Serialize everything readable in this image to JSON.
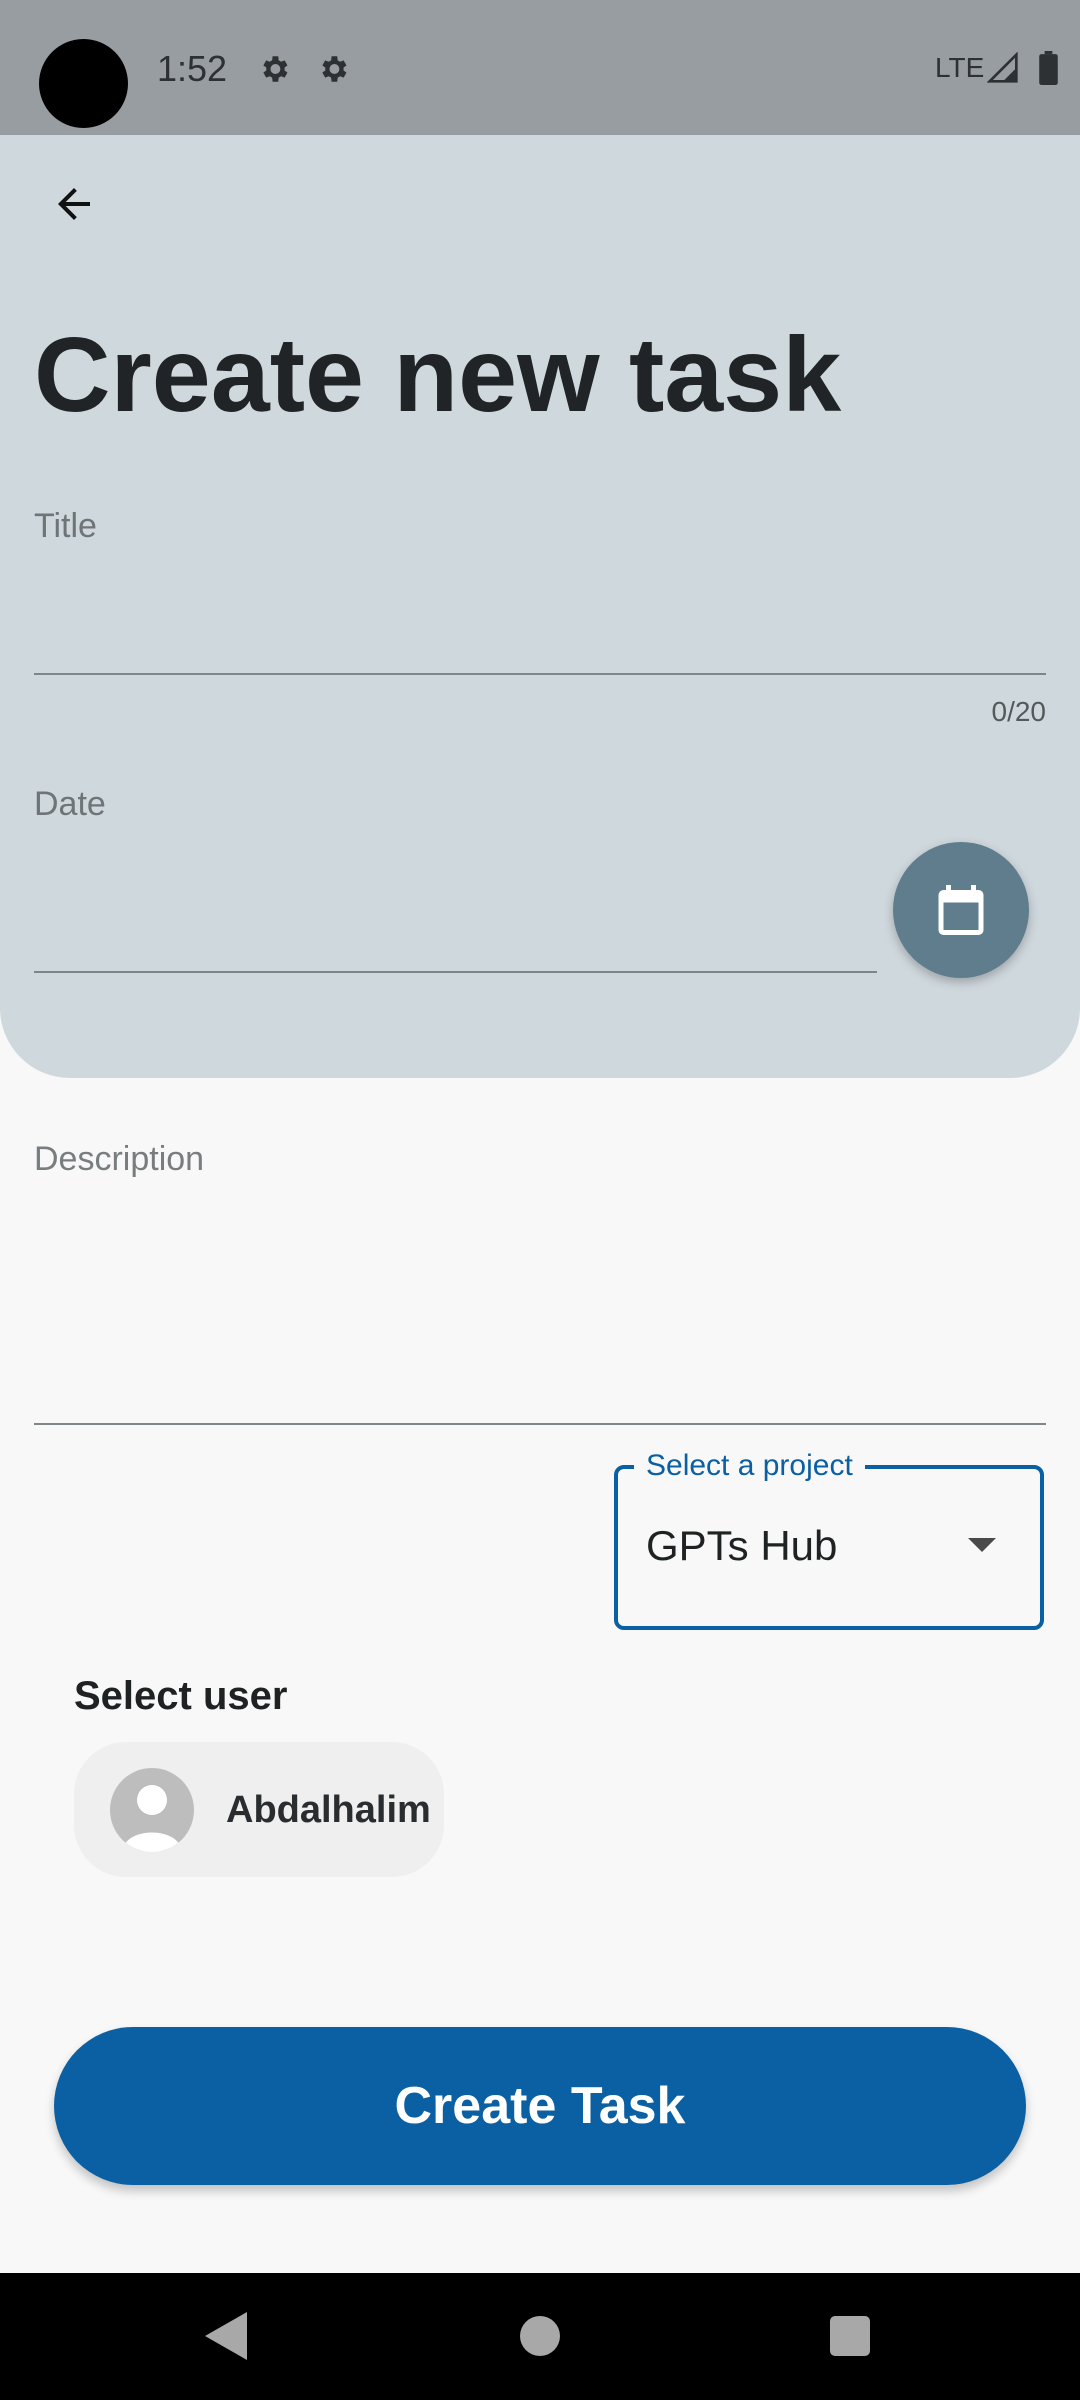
{
  "status_bar": {
    "time": "1:52",
    "network": "LTE",
    "icons": [
      "settings-gear-icon",
      "settings-gear-icon",
      "signal-icon",
      "battery-icon"
    ]
  },
  "header": {
    "back_icon": "arrow-back-icon",
    "title": "Create new task"
  },
  "form": {
    "title_label": "Title",
    "title_value": "",
    "title_counter": "0/20",
    "date_label": "Date",
    "date_value": "",
    "calendar_icon": "calendar-icon",
    "description_label": "Description",
    "description_value": ""
  },
  "project_select": {
    "label": "Select a project",
    "value": "GPTs Hub"
  },
  "user_select": {
    "label": "Select user",
    "users": [
      {
        "name": "Abdalhalim",
        "avatar": "default-avatar-icon"
      }
    ]
  },
  "actions": {
    "create_label": "Create Task"
  },
  "nav_bar": {
    "icons": [
      "nav-back-icon",
      "nav-home-icon",
      "nav-recents-icon"
    ]
  },
  "colors": {
    "primary": "#0b5fa3",
    "header_bg": "#cfd8dd",
    "status_bar_bg": "#979da0",
    "fab_bg": "#5f7d8c",
    "page_bg": "#f8f8f8"
  }
}
